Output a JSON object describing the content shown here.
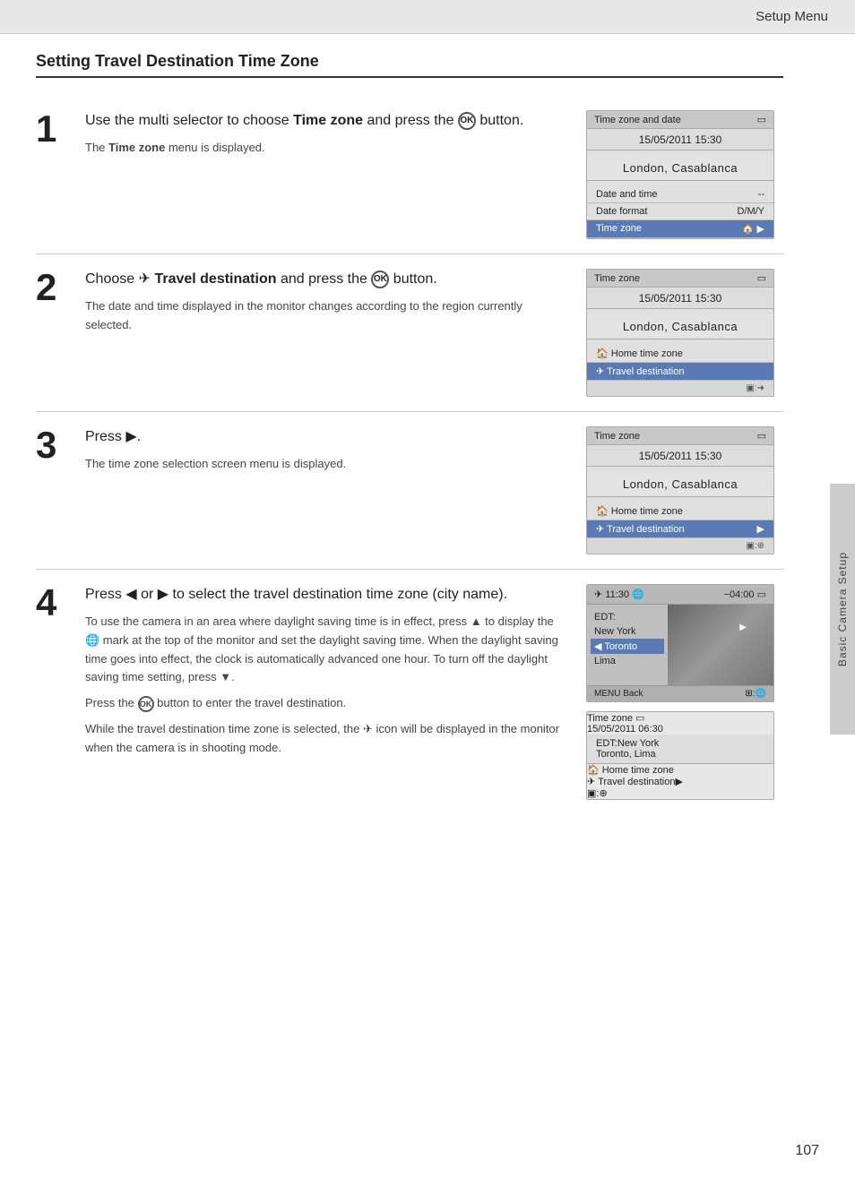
{
  "header": {
    "label": "Setup Menu"
  },
  "page_title": "Setting Travel Destination Time Zone",
  "side_tab": "Basic Camera Setup",
  "page_number": "107",
  "steps": [
    {
      "number": "1",
      "main": "Use the multi selector to choose <b>Time zone</b> and press the <ok/> button.",
      "sub": "The <b>Time zone</b> menu is displayed.",
      "screen": {
        "title": "Time zone and date",
        "date": "15/05/2011 15:30",
        "city": "London, Casablanca",
        "menu_items": [
          {
            "label": "Date and time",
            "value": "--",
            "highlighted": false
          },
          {
            "label": "Date format",
            "value": "D/M/Y",
            "highlighted": false
          },
          {
            "label": "Time zone",
            "value": "▶",
            "highlighted": true
          }
        ],
        "footer": ""
      }
    },
    {
      "number": "2",
      "main": "Choose ✈ <b>Travel destination</b> and press the <ok/> button.",
      "sub": "The date and time displayed in the monitor changes according to the region currently selected.",
      "screen": {
        "title": "Time zone",
        "date": "15/05/2011 15:30",
        "city": "London, Casablanca",
        "menu_items": [
          {
            "label": "🏠 Home time zone",
            "value": "",
            "highlighted": false
          },
          {
            "label": "✈ Travel destination",
            "value": "",
            "highlighted": true
          }
        ],
        "footer": "▣:➜"
      }
    },
    {
      "number": "3",
      "main": "Press ▶.",
      "sub": "The time zone selection screen menu is displayed.",
      "screen": {
        "title": "Time zone",
        "date": "15/05/2011 15:30",
        "city": "London, Casablanca",
        "menu_items": [
          {
            "label": "🏠 Home time zone",
            "value": "",
            "highlighted": false
          },
          {
            "label": "✈ Travel destination",
            "value": "▶",
            "highlighted": true
          }
        ],
        "footer": "▣:⊕"
      }
    },
    {
      "number": "4",
      "main": "Press ◀ or ▶ to select the travel destination time zone (city name).",
      "sub1": "To use the camera in an area where daylight saving time is in effect, press ▲ to display the 🌐 mark at the top of the monitor and set the daylight saving time. When the daylight saving time goes into effect, the clock is automatically advanced one hour. To turn off the daylight saving time setting, press ▼.",
      "sub2": "Press the <ok/> button to enter the travel destination.",
      "sub3": "While the travel destination time zone is selected, the ✈ icon will be displayed in the monitor when the camera is in shooting mode.",
      "world_screen": {
        "header_left": "✈ 11:30 🌐",
        "header_right": "−04:00 ◻",
        "cities": [
          {
            "label": "EDT:",
            "selected": false
          },
          {
            "label": "New York",
            "selected": false
          },
          {
            "label": "◀ Toronto",
            "selected": true
          },
          {
            "label": "Lima",
            "selected": false
          }
        ],
        "footer_left": "MENU Back",
        "footer_right": "⊞:🌐"
      },
      "screen2": {
        "title": "Time zone",
        "date": "15/05/2011 06:30",
        "city": "EDT:New York\nToronto, Lima",
        "menu_items": [
          {
            "label": "🏠 Home time zone",
            "value": "",
            "highlighted": false
          },
          {
            "label": "✈ Travel destination",
            "value": "▶",
            "highlighted": true
          }
        ],
        "footer": "▣:⊕"
      }
    }
  ]
}
